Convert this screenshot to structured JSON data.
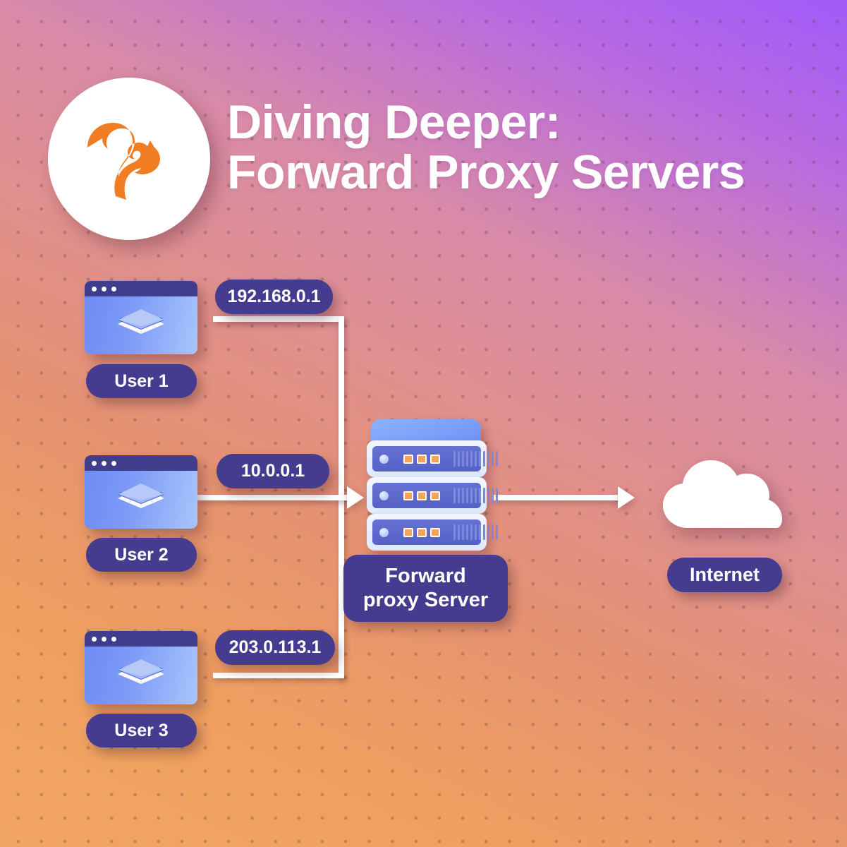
{
  "header": {
    "title_line1": "Diving Deeper:",
    "title_line2": "Forward Proxy Servers",
    "logo_alt": "squirrel-logo"
  },
  "diagram": {
    "type": "network-topology",
    "clients": [
      {
        "label": "User 1",
        "ip": "192.168.0.1"
      },
      {
        "label": "User 2",
        "ip": "10.0.0.1"
      },
      {
        "label": "User 3",
        "ip": "203.0.113.1"
      }
    ],
    "proxy": {
      "label_line1": "Forward",
      "label_line2": "proxy Server",
      "units": 3,
      "ports_per_unit": 3
    },
    "destination": {
      "label": "Internet",
      "icon": "cloud-icon"
    },
    "flow": "clients -> forward proxy server -> internet"
  },
  "colors": {
    "badge": "#453c90",
    "accent_orange": "#f07d22",
    "connector": "#ffffff",
    "card_bar": "#403e8c",
    "background_from": "#a05bf8",
    "background_to": "#f2a663"
  }
}
